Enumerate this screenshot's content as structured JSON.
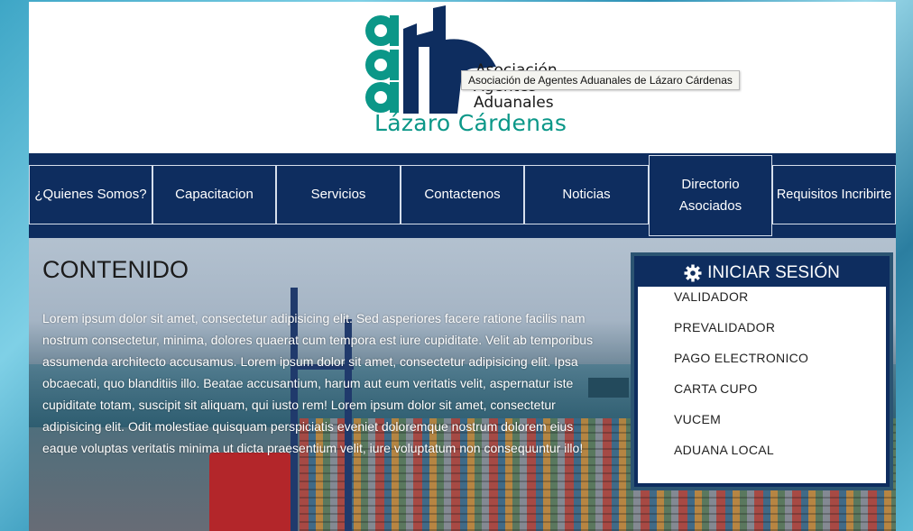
{
  "header": {
    "logo_line1": "Asociación",
    "logo_line2": "Agentes",
    "logo_line3": "Aduanales",
    "logo_name": "Lázaro Cárdenas",
    "tooltip": "Asociación de Agentes Aduanales de Lázaro Cárdenas"
  },
  "nav": {
    "items": [
      {
        "label": "¿Quienes Somos?"
      },
      {
        "label": "Capacitacion"
      },
      {
        "label": "Servicios"
      },
      {
        "label": "Contactenos"
      },
      {
        "label": "Noticias"
      },
      {
        "label": "Directorio Asociados"
      },
      {
        "label": "Requisitos Incribirte"
      }
    ],
    "active_index": 5
  },
  "content": {
    "title": "CONTENIDO",
    "body": "Lorem ipsum dolor sit amet, consectetur adipisicing elit. Sed asperiores facere ratione facilis nam nostrum consectetur, minima, dolores quaerat cum tempora est iure cupiditate. Velit ab temporibus assumenda architecto accusamus. Lorem ipsum dolor sit amet, consectetur adipisicing elit. Ipsa obcaecati, quo blanditiis illo. Beatae accusantium, harum aut eum veritatis velit, aspernatur iste cupiditate totam, suscipit sit aliquam, qui iusto rem! Lorem ipsum dolor sit amet, consectetur adipisicing elit. Odit molestiae quisquam perspiciatis eveniet doloremque nostrum dolorem eius eaque voluptas veritatis minima ut dicta praesentium velit, iure voluptatum non consequuntur illo!"
  },
  "login": {
    "title": "INICIAR SESIÓN",
    "icon": "gear-icon",
    "links": [
      "VALIDADOR",
      "PREVALIDADOR",
      "PAGO ELECTRONICO",
      "CARTA CUPO",
      "VUCEM",
      "ADUANA LOCAL"
    ]
  },
  "colors": {
    "navy": "#0e2d5f",
    "teal": "#0b9788"
  }
}
